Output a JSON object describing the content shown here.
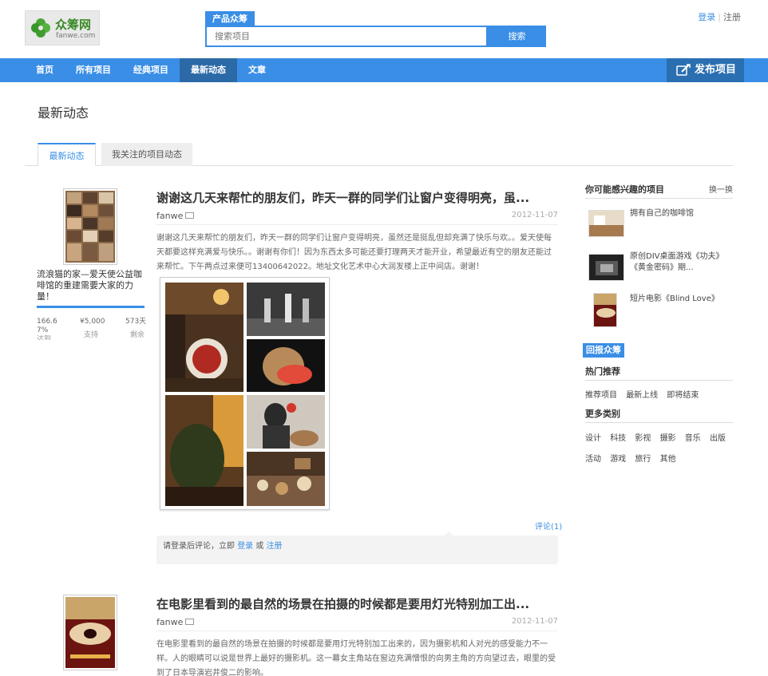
{
  "logo": {
    "title": "众筹网",
    "subtitle": "fanwe.com"
  },
  "search": {
    "tag": "产品众筹",
    "placeholder": "搜索项目",
    "button": "搜索"
  },
  "auth": {
    "login": "登录",
    "sep": "|",
    "register": "注册"
  },
  "nav": {
    "items": [
      {
        "label": "首页"
      },
      {
        "label": "所有项目"
      },
      {
        "label": "经典项目"
      },
      {
        "label": "最新动态"
      },
      {
        "label": "文章"
      }
    ],
    "publish": "发布项目"
  },
  "page_title": "最新动态",
  "tabs": [
    {
      "label": "最新动态"
    },
    {
      "label": "我关注的项目动态"
    }
  ],
  "feed": [
    {
      "project_name": "流浪猫的家—爱天使公益咖啡馆的重建需要大家的力量！",
      "stats": [
        {
          "value": "166.6",
          "value2": "7%",
          "label": "达到"
        },
        {
          "value": "¥5,000",
          "label": "支持"
        },
        {
          "value": "573天",
          "label": "剩余"
        }
      ],
      "title": "谢谢这几天来帮忙的朋友们，昨天一群的同学们让窗户变得明亮，虽...",
      "author": "fanwe",
      "date": "2012-11-07",
      "body": "谢谢这几天来帮忙的朋友们，昨天一群的同学们让窗户变得明亮，虽然还是挺乱但却充满了快乐与欢。。爱天使每天都要这样充满爱与快乐。。谢谢有你们！因为东西太多可能还要打理两天才能开业，希望最近有空的朋友还能过来帮忙。下午两点过来便可13400642022。地址文化艺术中心大润发楼上正中间店。谢谢！",
      "comments": "评论(1)",
      "comment_prompt": "请登录后评论，立即",
      "comment_login": "登录",
      "comment_or": "或",
      "comment_register": "注册"
    },
    {
      "title": "在电影里看到的最自然的场景在拍摄的时候都是要用灯光特别加工出...",
      "author": "fanwe",
      "date": "2012-11-07",
      "body": "在电影里看到的最自然的场景在拍摄的时候都是要用灯光特别加工出来的，因为摄影机和人对光的感受能力不一样。人的眼睛可以说是世界上最好的摄影机。这一幕女主角站在窗边充满憎恨的向男主角的方向望过去，眼里的受到了日本导演岩井俊二的影响。"
    }
  ],
  "sidebar": {
    "interest_title": "你可能感兴趣的项目",
    "refresh": "换一换",
    "recommendations": [
      {
        "title": "拥有自己的咖啡馆"
      },
      {
        "title": "原创DIV桌面游戏《功夫》《黄金密码》期..."
      },
      {
        "title": "短片电影《Blind Love》"
      }
    ],
    "badge": "回报众筹",
    "hot_title": "热门推荐",
    "hot_links": [
      "推荐项目",
      "最新上线",
      "即将结束"
    ],
    "more_title": "更多类别",
    "categories_row1": [
      "设计",
      "科技",
      "影视",
      "摄影",
      "音乐",
      "出版"
    ],
    "categories_row2": [
      "活动",
      "游戏",
      "旅行",
      "其他"
    ]
  },
  "colors": {
    "brand_blue": "#3a8ee6",
    "nav_active": "#2c6aa7"
  }
}
